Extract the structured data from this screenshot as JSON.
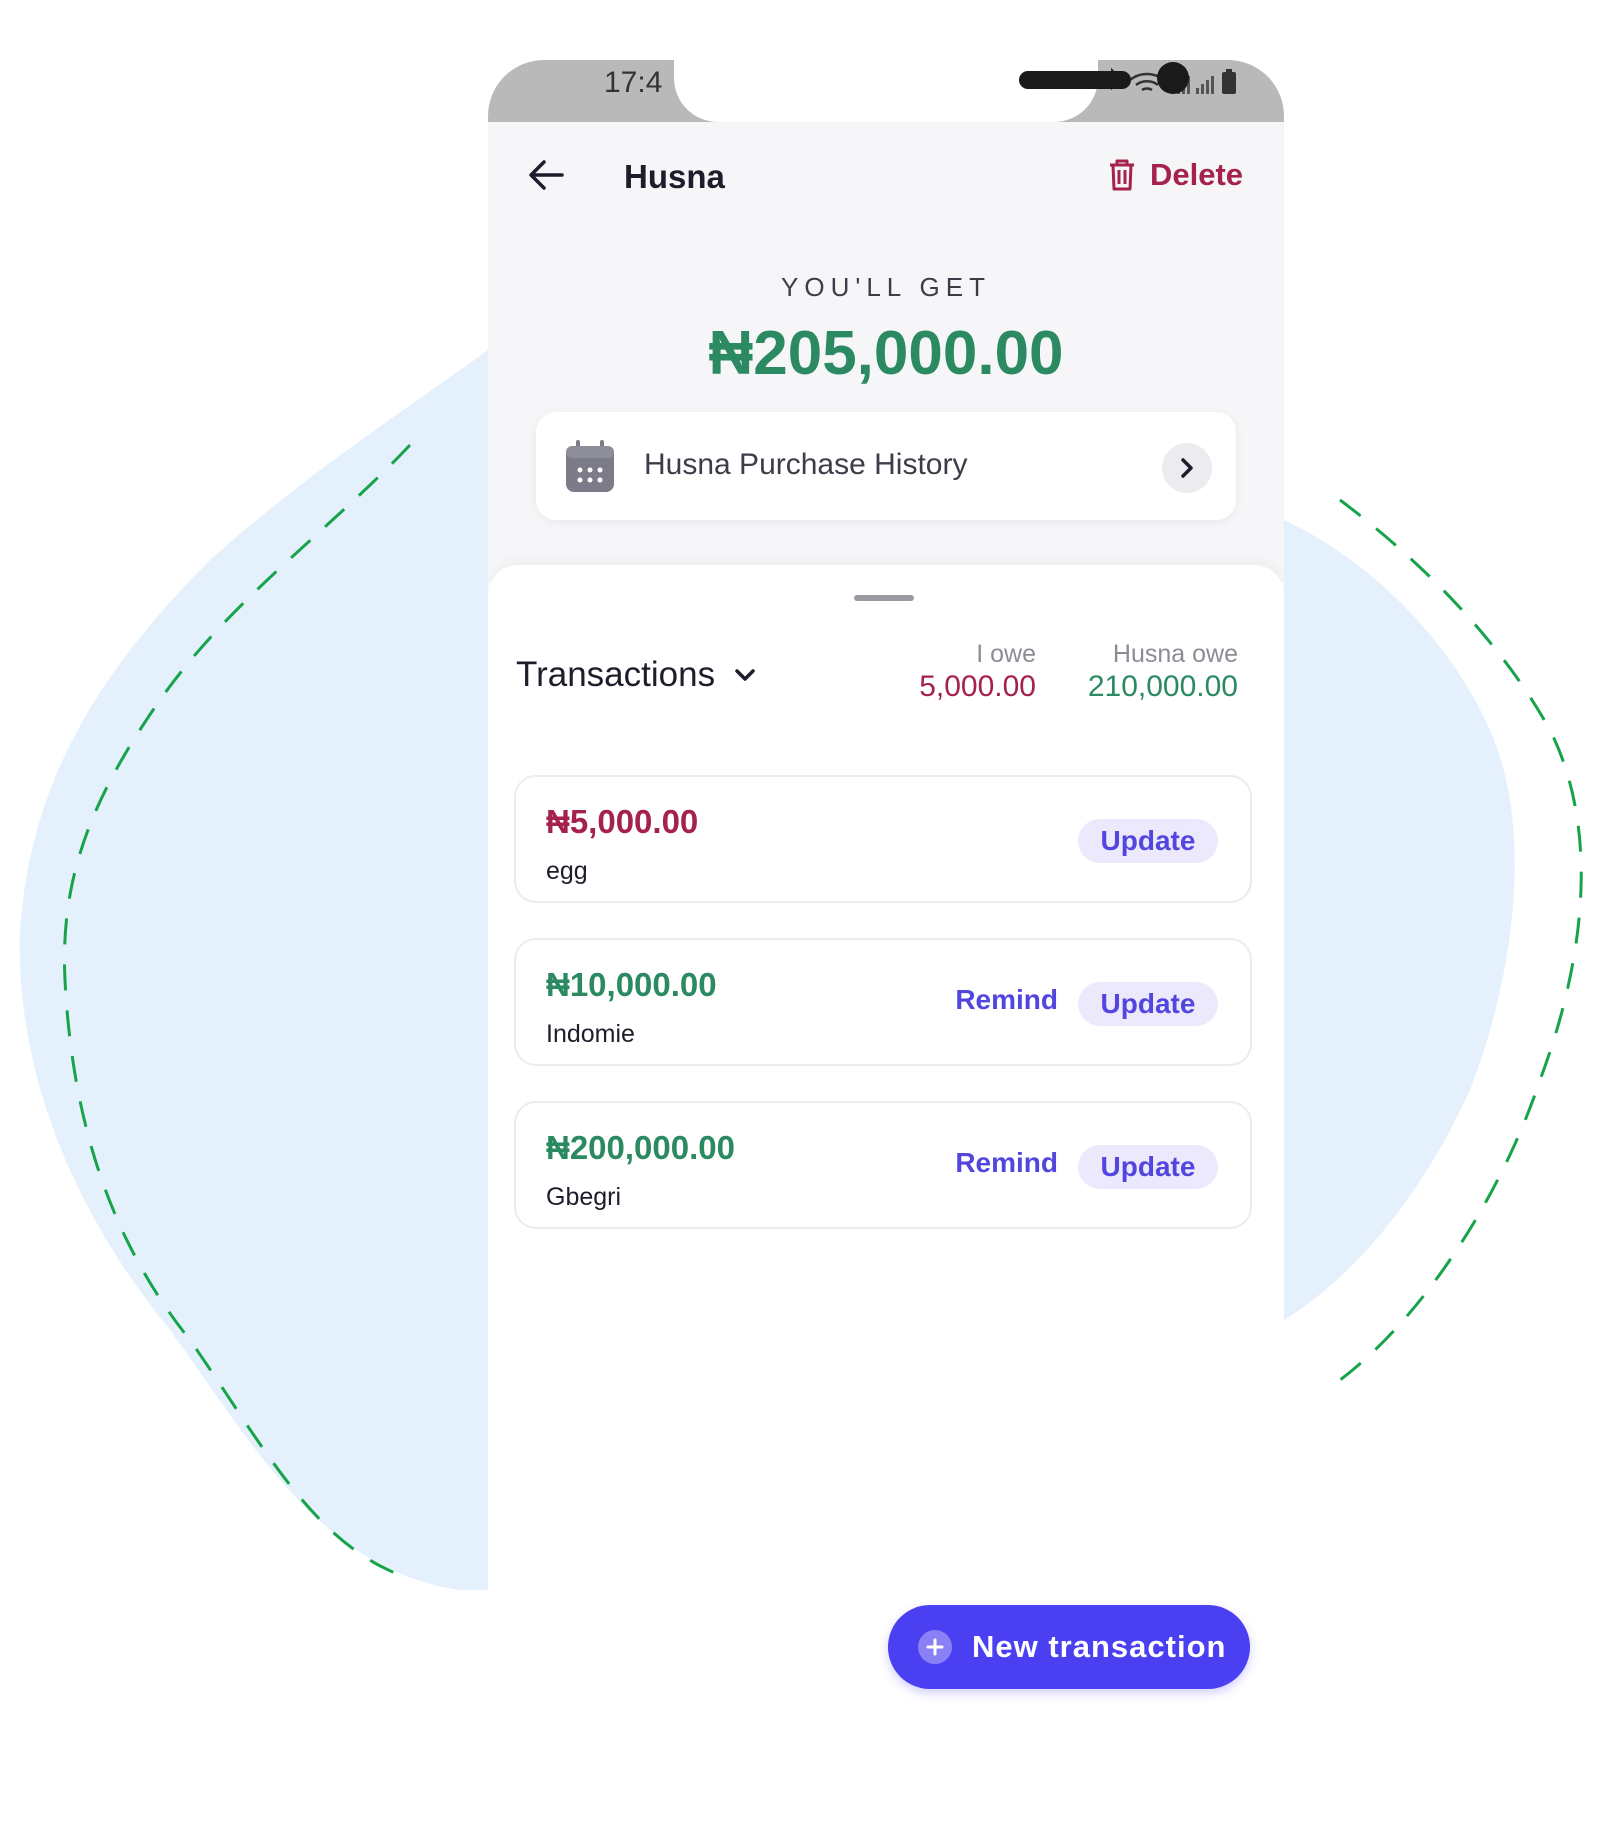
{
  "status_bar": {
    "time": "17:4"
  },
  "header": {
    "contact_name": "Husna",
    "delete_label": "Delete"
  },
  "summary": {
    "label": "YOU'LL GET",
    "amount": "₦205,000.00"
  },
  "history": {
    "label": "Husna Purchase History"
  },
  "transactions_header": {
    "title": "Transactions",
    "i_owe_label": "I owe",
    "i_owe_value": "5,000.00",
    "they_owe_label": "Husna owe",
    "they_owe_value": "210,000.00"
  },
  "transactions": [
    {
      "amount": "₦5,000.00",
      "description": "egg",
      "update_label": "Update",
      "remind_label": "",
      "direction": "owe"
    },
    {
      "amount": "₦10,000.00",
      "description": "Indomie",
      "update_label": "Update",
      "remind_label": "Remind",
      "direction": "get"
    },
    {
      "amount": "₦200,000.00",
      "description": "Gbegri",
      "update_label": "Update",
      "remind_label": "Remind",
      "direction": "get"
    }
  ],
  "new_transaction": {
    "label": "New transaction"
  },
  "colors": {
    "owe": "#a4224b",
    "get": "#2b8a62",
    "accent": "#4b3ff2",
    "backdrop_blob": "#e4f1fc",
    "dashed_outline": "#16a34a"
  },
  "icons": {
    "back": "arrow-left-icon",
    "delete": "trash-icon",
    "history": "calendar-icon",
    "history_open": "chevron-right-icon",
    "dropdown": "chevron-down-icon",
    "new_transaction": "plus-circle-icon"
  }
}
